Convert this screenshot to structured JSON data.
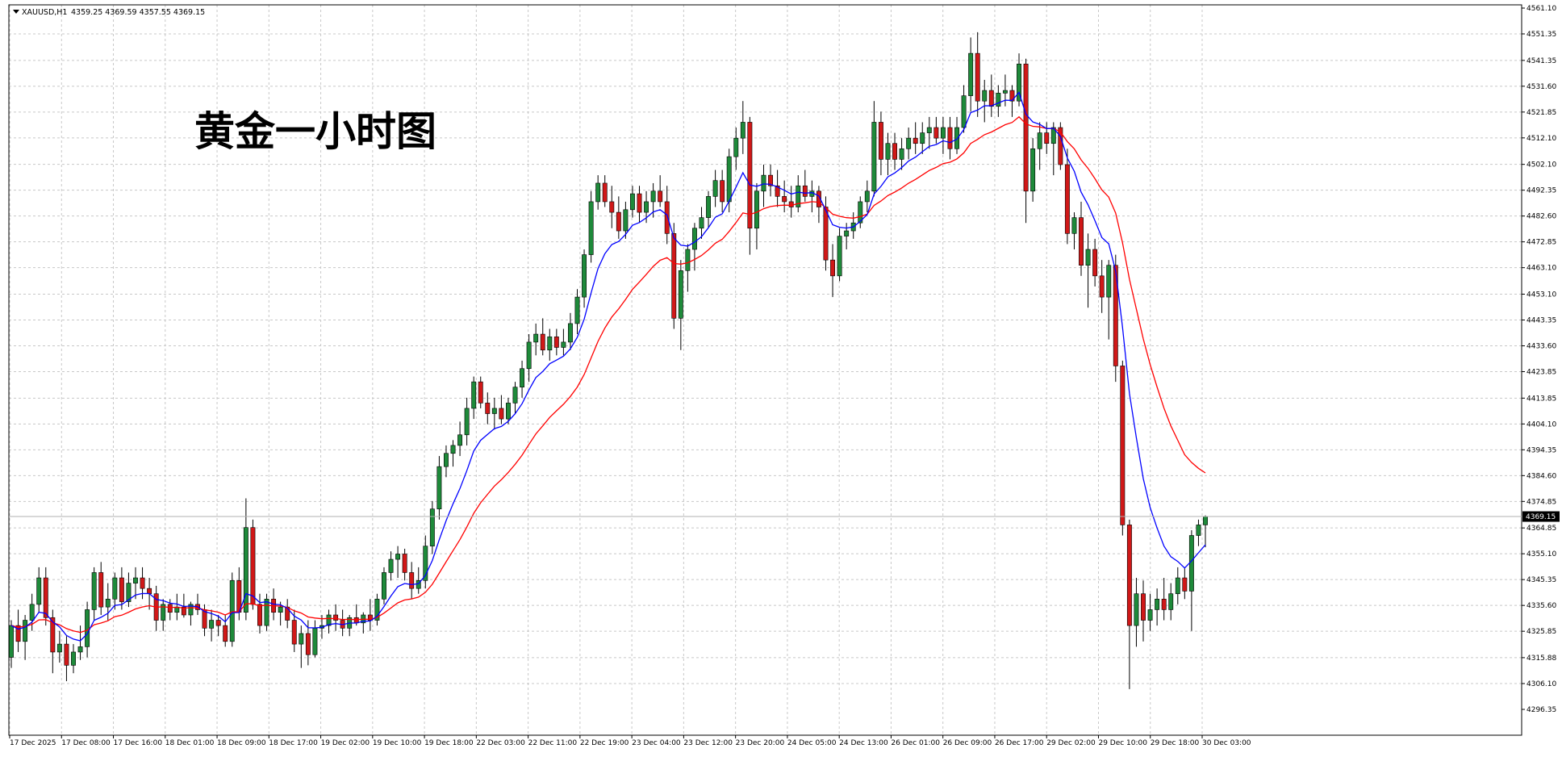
{
  "header": {
    "symbol": "XAUUSD,H1",
    "ohlc": "4359.25 4369.59 4357.55 4369.15"
  },
  "annotation": "黄金一小时图",
  "current_price_label": "4369.15",
  "colors": {
    "bull": "#1e8a3a",
    "bear": "#d01818",
    "ma_fast": "#0000ff",
    "ma_slow": "#ff0000",
    "grid": "#c8c8c8"
  },
  "chart_data": {
    "type": "candlestick",
    "symbol": "XAUUSD",
    "timeframe": "H1",
    "ylim": [
      4296.35,
      4561.1
    ],
    "yticks": [
      "4561.10",
      "4551.35",
      "4541.35",
      "4531.60",
      "4521.85",
      "4512.10",
      "4502.10",
      "4492.35",
      "4482.60",
      "4472.85",
      "4463.10",
      "4453.10",
      "4443.35",
      "4433.60",
      "4423.85",
      "4413.85",
      "4404.10",
      "4394.35",
      "4384.60",
      "4374.85",
      "4364.85",
      "4355.10",
      "4345.35",
      "4335.60",
      "4325.85",
      "4315.88",
      "4306.10",
      "4296.35"
    ],
    "xticks": [
      "17 Dec 2025",
      "17 Dec 08:00",
      "17 Dec 16:00",
      "18 Dec 01:00",
      "18 Dec 09:00",
      "18 Dec 17:00",
      "19 Dec 02:00",
      "19 Dec 10:00",
      "19 Dec 18:00",
      "22 Dec 03:00",
      "22 Dec 11:00",
      "22 Dec 19:00",
      "23 Dec 04:00",
      "23 Dec 12:00",
      "23 Dec 20:00",
      "24 Dec 05:00",
      "24 Dec 13:00",
      "26 Dec 01:00",
      "26 Dec 09:00",
      "26 Dec 17:00",
      "29 Dec 02:00",
      "29 Dec 10:00",
      "29 Dec 18:00",
      "30 Dec 03:00"
    ],
    "candles": [
      [
        4316,
        4330,
        4312,
        4328
      ],
      [
        4328,
        4334,
        4318,
        4322
      ],
      [
        4322,
        4332,
        4315,
        4330
      ],
      [
        4330,
        4340,
        4326,
        4336
      ],
      [
        4336,
        4350,
        4333,
        4346
      ],
      [
        4346,
        4350,
        4328,
        4331
      ],
      [
        4331,
        4334,
        4310,
        4318
      ],
      [
        4318,
        4326,
        4314,
        4321
      ],
      [
        4321,
        4324,
        4307,
        4313
      ],
      [
        4313,
        4321,
        4310,
        4318
      ],
      [
        4318,
        4328,
        4315,
        4320
      ],
      [
        4320,
        4337,
        4316,
        4334
      ],
      [
        4334,
        4350,
        4330,
        4348
      ],
      [
        4348,
        4352,
        4332,
        4335
      ],
      [
        4335,
        4344,
        4330,
        4338
      ],
      [
        4338,
        4348,
        4334,
        4346
      ],
      [
        4346,
        4350,
        4334,
        4337
      ],
      [
        4337,
        4348,
        4335,
        4344
      ],
      [
        4344,
        4350,
        4338,
        4346
      ],
      [
        4346,
        4350,
        4338,
        4342
      ],
      [
        4342,
        4346,
        4334,
        4340
      ],
      [
        4340,
        4343,
        4326,
        4330
      ],
      [
        4330,
        4338,
        4326,
        4336
      ],
      [
        4336,
        4338,
        4330,
        4333
      ],
      [
        4333,
        4340,
        4330,
        4335
      ],
      [
        4335,
        4340,
        4331,
        4332
      ],
      [
        4332,
        4337,
        4328,
        4336
      ],
      [
        4336,
        4340,
        4332,
        4334
      ],
      [
        4334,
        4336,
        4324,
        4327
      ],
      [
        4327,
        4334,
        4322,
        4330
      ],
      [
        4330,
        4332,
        4324,
        4328
      ],
      [
        4328,
        4332,
        4320,
        4322
      ],
      [
        4322,
        4348,
        4320,
        4345
      ],
      [
        4345,
        4350,
        4330,
        4333
      ],
      [
        4333,
        4376,
        4330,
        4365
      ],
      [
        4365,
        4368,
        4334,
        4336
      ],
      [
        4336,
        4340,
        4325,
        4328
      ],
      [
        4328,
        4340,
        4326,
        4338
      ],
      [
        4338,
        4342,
        4330,
        4333
      ],
      [
        4333,
        4337,
        4328,
        4335
      ],
      [
        4335,
        4338,
        4327,
        4330
      ],
      [
        4330,
        4334,
        4318,
        4321
      ],
      [
        4321,
        4328,
        4312,
        4325
      ],
      [
        4325,
        4330,
        4313,
        4317
      ],
      [
        4317,
        4330,
        4316,
        4327
      ],
      [
        4327,
        4332,
        4323,
        4328
      ],
      [
        4328,
        4334,
        4325,
        4332
      ],
      [
        4332,
        4336,
        4326,
        4330
      ],
      [
        4330,
        4334,
        4324,
        4327
      ],
      [
        4327,
        4332,
        4324,
        4331
      ],
      [
        4331,
        4336,
        4328,
        4329
      ],
      [
        4329,
        4333,
        4325,
        4332
      ],
      [
        4332,
        4338,
        4326,
        4330
      ],
      [
        4330,
        4340,
        4328,
        4338
      ],
      [
        4338,
        4350,
        4336,
        4348
      ],
      [
        4348,
        4356,
        4345,
        4353
      ],
      [
        4353,
        4358,
        4346,
        4355
      ],
      [
        4355,
        4357,
        4345,
        4348
      ],
      [
        4348,
        4352,
        4338,
        4342
      ],
      [
        4342,
        4350,
        4340,
        4345
      ],
      [
        4345,
        4362,
        4342,
        4358
      ],
      [
        4358,
        4375,
        4355,
        4372
      ],
      [
        4372,
        4392,
        4368,
        4388
      ],
      [
        4388,
        4396,
        4384,
        4393
      ],
      [
        4393,
        4398,
        4388,
        4396
      ],
      [
        4396,
        4405,
        4392,
        4400
      ],
      [
        4400,
        4414,
        4396,
        4410
      ],
      [
        4410,
        4422,
        4406,
        4420
      ],
      [
        4420,
        4422,
        4410,
        4412
      ],
      [
        4412,
        4416,
        4404,
        4408
      ],
      [
        4408,
        4414,
        4402,
        4410
      ],
      [
        4410,
        4415,
        4404,
        4406
      ],
      [
        4406,
        4414,
        4404,
        4412
      ],
      [
        4412,
        4420,
        4408,
        4418
      ],
      [
        4418,
        4428,
        4414,
        4425
      ],
      [
        4425,
        4438,
        4420,
        4435
      ],
      [
        4435,
        4442,
        4430,
        4438
      ],
      [
        4438,
        4444,
        4430,
        4432
      ],
      [
        4432,
        4440,
        4428,
        4437
      ],
      [
        4437,
        4440,
        4430,
        4433
      ],
      [
        4433,
        4440,
        4430,
        4435
      ],
      [
        4435,
        4446,
        4432,
        4442
      ],
      [
        4442,
        4455,
        4438,
        4452
      ],
      [
        4452,
        4470,
        4448,
        4468
      ],
      [
        4468,
        4492,
        4465,
        4488
      ],
      [
        4488,
        4498,
        4485,
        4495
      ],
      [
        4495,
        4498,
        4486,
        4488
      ],
      [
        4488,
        4494,
        4478,
        4484
      ],
      [
        4484,
        4490,
        4474,
        4477
      ],
      [
        4477,
        4488,
        4474,
        4485
      ],
      [
        4485,
        4494,
        4482,
        4491
      ],
      [
        4491,
        4494,
        4480,
        4484
      ],
      [
        4484,
        4492,
        4480,
        4488
      ],
      [
        4488,
        4495,
        4482,
        4492
      ],
      [
        4492,
        4498,
        4486,
        4488
      ],
      [
        4488,
        4494,
        4472,
        4476
      ],
      [
        4476,
        4480,
        4440,
        4444
      ],
      [
        4444,
        4466,
        4432,
        4462
      ],
      [
        4462,
        4472,
        4454,
        4470
      ],
      [
        4470,
        4480,
        4462,
        4478
      ],
      [
        4478,
        4486,
        4474,
        4482
      ],
      [
        4482,
        4492,
        4478,
        4490
      ],
      [
        4490,
        4500,
        4486,
        4496
      ],
      [
        4496,
        4500,
        4484,
        4488
      ],
      [
        4488,
        4508,
        4484,
        4505
      ],
      [
        4505,
        4516,
        4500,
        4512
      ],
      [
        4512,
        4526,
        4506,
        4518
      ],
      [
        4518,
        4520,
        4468,
        4478
      ],
      [
        4478,
        4495,
        4470,
        4492
      ],
      [
        4492,
        4502,
        4486,
        4498
      ],
      [
        4498,
        4502,
        4490,
        4494
      ],
      [
        4494,
        4500,
        4486,
        4490
      ],
      [
        4490,
        4496,
        4484,
        4488
      ],
      [
        4488,
        4494,
        4482,
        4486
      ],
      [
        4486,
        4498,
        4484,
        4494
      ],
      [
        4494,
        4500,
        4488,
        4490
      ],
      [
        4490,
        4496,
        4484,
        4492
      ],
      [
        4492,
        4494,
        4480,
        4486
      ],
      [
        4486,
        4490,
        4462,
        4466
      ],
      [
        4466,
        4472,
        4452,
        4460
      ],
      [
        4460,
        4478,
        4458,
        4475
      ],
      [
        4475,
        4480,
        4470,
        4477
      ],
      [
        4477,
        4484,
        4474,
        4480
      ],
      [
        4480,
        4490,
        4478,
        4488
      ],
      [
        4488,
        4496,
        4484,
        4492
      ],
      [
        4492,
        4526,
        4490,
        4518
      ],
      [
        4518,
        4522,
        4498,
        4504
      ],
      [
        4504,
        4514,
        4498,
        4510
      ],
      [
        4510,
        4514,
        4500,
        4504
      ],
      [
        4504,
        4512,
        4500,
        4508
      ],
      [
        4508,
        4516,
        4504,
        4512
      ],
      [
        4512,
        4518,
        4506,
        4510
      ],
      [
        4510,
        4518,
        4506,
        4514
      ],
      [
        4514,
        4520,
        4508,
        4516
      ],
      [
        4516,
        4520,
        4510,
        4512
      ],
      [
        4512,
        4520,
        4506,
        4516
      ],
      [
        4516,
        4520,
        4504,
        4508
      ],
      [
        4508,
        4520,
        4506,
        4516
      ],
      [
        4516,
        4532,
        4514,
        4528
      ],
      [
        4528,
        4550,
        4522,
        4544
      ],
      [
        4544,
        4552,
        4520,
        4526
      ],
      [
        4526,
        4534,
        4518,
        4530
      ],
      [
        4530,
        4536,
        4520,
        4524
      ],
      [
        4524,
        4532,
        4520,
        4529
      ],
      [
        4529,
        4536,
        4524,
        4530
      ],
      [
        4530,
        4532,
        4520,
        4526
      ],
      [
        4526,
        4544,
        4524,
        4540
      ],
      [
        4540,
        4542,
        4480,
        4492
      ],
      [
        4492,
        4512,
        4488,
        4508
      ],
      [
        4508,
        4518,
        4500,
        4514
      ],
      [
        4514,
        4518,
        4506,
        4510
      ],
      [
        4510,
        4518,
        4498,
        4516
      ],
      [
        4516,
        4518,
        4500,
        4502
      ],
      [
        4502,
        4508,
        4472,
        4476
      ],
      [
        4476,
        4484,
        4470,
        4482
      ],
      [
        4482,
        4488,
        4460,
        4464
      ],
      [
        4464,
        4476,
        4448,
        4470
      ],
      [
        4470,
        4474,
        4456,
        4460
      ],
      [
        4460,
        4466,
        4446,
        4452
      ],
      [
        4452,
        4466,
        4436,
        4464
      ],
      [
        4464,
        4468,
        4420,
        4426
      ],
      [
        4426,
        4428,
        4362,
        4366
      ],
      [
        4366,
        4368,
        4304,
        4328
      ],
      [
        4328,
        4346,
        4320,
        4340
      ],
      [
        4340,
        4345,
        4322,
        4330
      ],
      [
        4330,
        4340,
        4326,
        4334
      ],
      [
        4334,
        4342,
        4328,
        4338
      ],
      [
        4338,
        4346,
        4330,
        4334
      ],
      [
        4334,
        4344,
        4330,
        4340
      ],
      [
        4340,
        4350,
        4336,
        4346
      ],
      [
        4346,
        4350,
        4338,
        4341
      ],
      [
        4341,
        4364,
        4326,
        4362
      ],
      [
        4362,
        4368,
        4358,
        4366
      ],
      [
        4366,
        4369.59,
        4357.55,
        4369.15
      ]
    ],
    "series": [
      {
        "name": "",
        "color": "#0000ff"
      },
      {
        "name": "",
        "color": "#ff0000"
      }
    ]
  }
}
